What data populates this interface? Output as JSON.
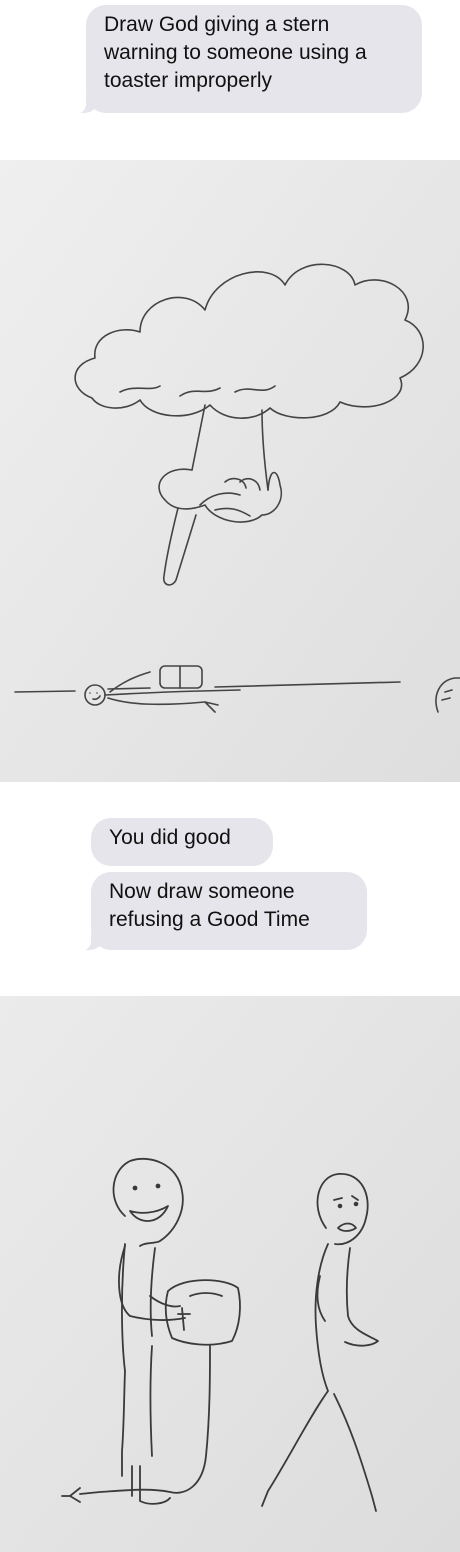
{
  "messages": {
    "first": "Draw God giving a stern warning to someone using a toaster improperly",
    "second": "You did good",
    "third": "Now draw someone refusing a Good Time"
  },
  "sketches": {
    "first": "god-hand-pointing-at-electrocuted-person-sketch",
    "second": "person-offering-toaster-to-reluctant-person-sketch"
  },
  "colors": {
    "bubble": "#e6e5eb",
    "paper_top": "#ececec",
    "paper_bottom": "#e2e2e2",
    "pencil": "#3a3a3a"
  }
}
